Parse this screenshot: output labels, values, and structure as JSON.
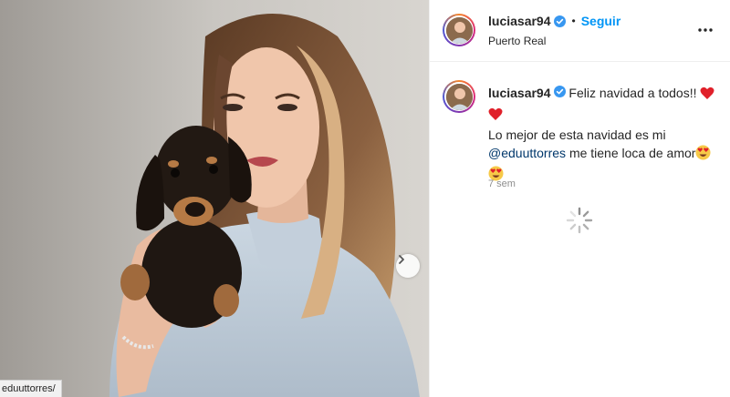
{
  "post": {
    "username": "luciasar94",
    "follow_label": "Seguir",
    "dot": "•",
    "location": "Puerto Real",
    "caption": {
      "line1": "Feliz navidad a todos!!",
      "line2": "Lo mejor de esta navidad es mi",
      "mention": "@eduuttorres",
      "line3_rest": "me tiene loca de amor"
    },
    "timestamp": "7 sem"
  },
  "browser": {
    "status_link": "eduuttorres/"
  },
  "icons": {
    "verified": "verified-badge-icon",
    "more": "more-options-icon",
    "next": "chevron-right-icon",
    "spinner": "loading-spinner-icon",
    "heart": "red-heart-emoji",
    "heart_eyes": "heart-eyes-emoji"
  },
  "colors": {
    "accent": "#0095f6",
    "mention": "#00376b",
    "muted": "#8e8e8e",
    "verified": "#3897f0"
  }
}
